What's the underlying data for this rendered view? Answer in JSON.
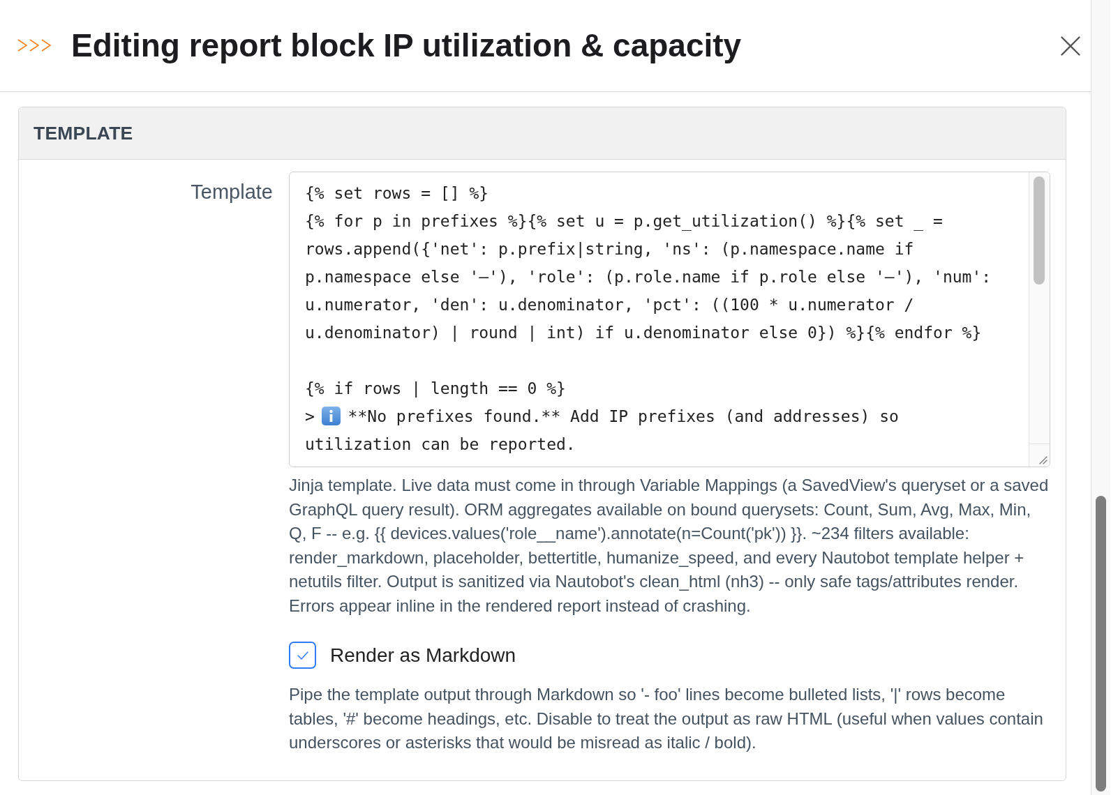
{
  "header": {
    "title": "Editing report block IP utilization & capacity"
  },
  "section": {
    "title": "TEMPLATE",
    "template_field": {
      "label": "Template",
      "lines": [
        {
          "kind": "code",
          "text": "{% set rows = [] %}"
        },
        {
          "kind": "code",
          "text": "{% for p in prefixes %}{% set u = p.get_utilization() %}{% set _ = rows.append({'net': p.prefix|string, 'ns': (p.namespace.name if p.namespace else '—'), 'role': (p.role.name if p.role else '—'), 'num': u.numerator, 'den': u.denominator, 'pct': ((100 * u.numerator / u.denominator) | round | int) if u.denominator else 0}) %}{% endfor %}"
        },
        {
          "kind": "blank"
        },
        {
          "kind": "code",
          "text": "{% if rows | length == 0 %}"
        },
        {
          "kind": "callout",
          "before": ">",
          "after": "**No prefixes found.** Add IP prefixes (and addresses) so utilization can be reported."
        }
      ],
      "help_text": "Jinja template. Live data must come in through Variable Mappings (a SavedView's queryset or a saved GraphQL query result). ORM aggregates available on bound querysets: Count, Sum, Avg, Max, Min, Q, F -- e.g. {{ devices.values('role__name').annotate(n=Count('pk')) }}. ~234 filters available: render_markdown, placeholder, bettertitle, humanize_speed, and every Nautobot template helper + netutils filter. Output is sanitized via Nautobot's clean_html (nh3) -- only safe tags/attributes render. Errors appear inline in the rendered report instead of crashing."
    },
    "render_markdown": {
      "label": "Render as Markdown",
      "checked": true,
      "help_text": "Pipe the template output through Markdown so '- foo' lines become bulleted lists, '|' rows become tables, '#' become headings, etc. Disable to treat the output as raw HTML (useful when values contain underscores or asterisks that would be misread as italic / bold)."
    }
  }
}
